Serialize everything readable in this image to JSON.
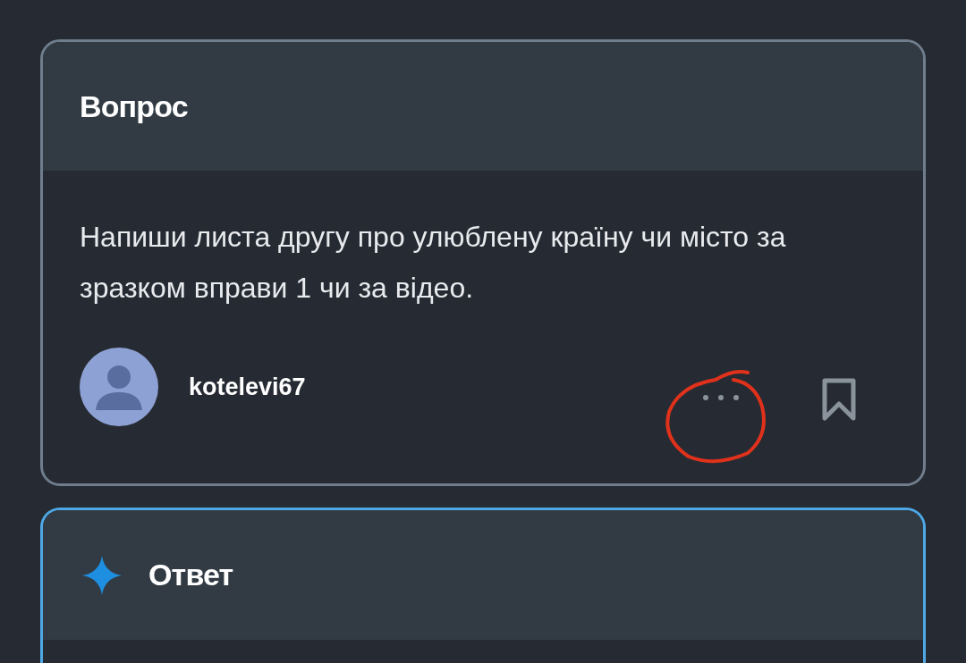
{
  "question_card": {
    "title": "Вопрос",
    "text": "Напиши листа другу про улюблену країну чи місто за зразком вправи 1 чи за відео.",
    "author": "kotelevi67"
  },
  "answer_card": {
    "title": "Ответ"
  }
}
